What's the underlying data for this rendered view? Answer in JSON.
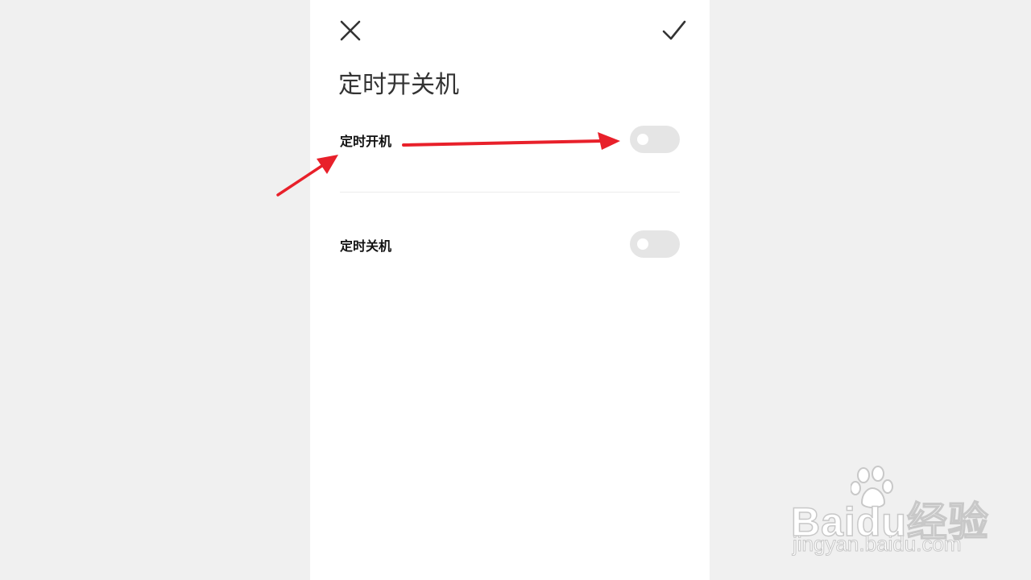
{
  "header": {
    "close_icon": "close-icon",
    "confirm_icon": "checkmark-icon",
    "title": "定时开关机"
  },
  "settings": [
    {
      "label": "定时开机",
      "enabled": false
    },
    {
      "label": "定时关机",
      "enabled": false
    }
  ],
  "annotation": {
    "arrow_color": "#e8202a"
  },
  "watermark": {
    "brand": "Baidu经验",
    "url": "jingyan.baidu.com"
  },
  "colors": {
    "background": "#f0f0f0",
    "panel": "#ffffff",
    "toggle_off": "#e5e5e5",
    "text": "#111111"
  }
}
